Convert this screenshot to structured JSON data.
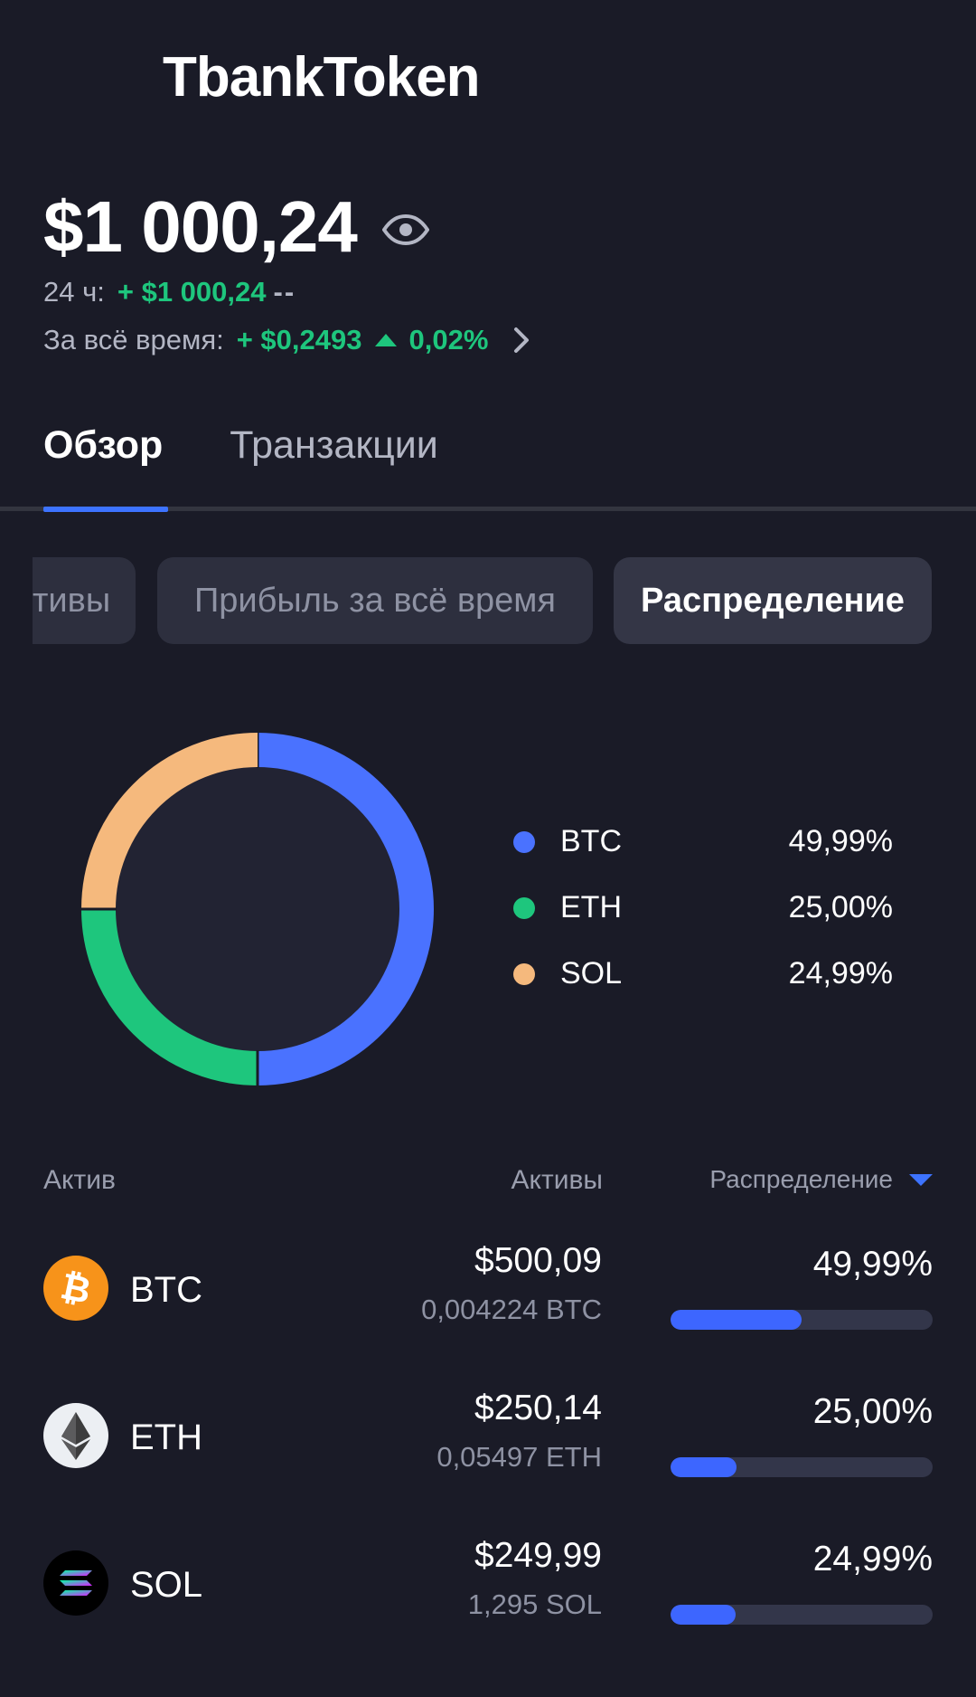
{
  "app": {
    "title": "TbankToken"
  },
  "portfolio": {
    "balance": "$1 000,24",
    "day_label": "24 ч:",
    "day_change": "+ $1 000,24",
    "day_pct": "--",
    "alltime_label": "За всё время:",
    "alltime_change": "+ $0,2493",
    "alltime_pct": "0,02%"
  },
  "tabs": [
    {
      "label": "Обзор",
      "active": true
    },
    {
      "label": "Транзакции",
      "active": false
    }
  ],
  "chips": [
    {
      "label": "тивы"
    },
    {
      "label": "Прибыль за всё время"
    },
    {
      "label": "Распределение",
      "selected": true
    }
  ],
  "allocation": {
    "items": [
      {
        "name": "BTC",
        "pct": "49,99%",
        "value": 49.99,
        "color": "#4a72ff"
      },
      {
        "name": "ETH",
        "pct": "25,00%",
        "value": 25.0,
        "color": "#1ec67d"
      },
      {
        "name": "SOL",
        "pct": "24,99%",
        "value": 24.99,
        "color": "#f5b97d"
      }
    ]
  },
  "list": {
    "header": {
      "asset": "Актив",
      "amount": "Активы",
      "distribution": "Распределение"
    },
    "rows": [
      {
        "symbol": "BTC",
        "usd": "$500,09",
        "qty": "0,004224 BTC",
        "pct": "49,99%",
        "share": 0.4999,
        "icon": "bitcoin-icon"
      },
      {
        "symbol": "ETH",
        "usd": "$250,14",
        "qty": "0,05497 ETH",
        "pct": "25,00%",
        "share": 0.25,
        "icon": "ethereum-icon"
      },
      {
        "symbol": "SOL",
        "usd": "$249,99",
        "qty": "1,295 SOL",
        "pct": "24,99%",
        "share": 0.2499,
        "icon": "solana-icon"
      }
    ]
  }
}
